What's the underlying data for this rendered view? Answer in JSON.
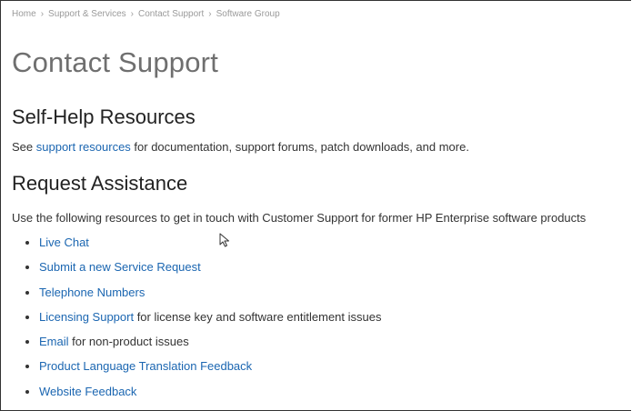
{
  "breadcrumb": [
    "Home",
    "Support & Services",
    "Contact Support",
    "Software Group"
  ],
  "breadcrumb_separator": "›",
  "page_title": "Contact Support",
  "self_help": {
    "heading": "Self-Help Resources",
    "text_before": "See ",
    "link": "support resources",
    "text_after": " for documentation, support forums, patch downloads, and more."
  },
  "request": {
    "heading": "Request Assistance",
    "intro": "Use the following resources to get in touch with Customer Support for former HP Enterprise software products",
    "items": [
      {
        "link": "Live Chat",
        "suffix": ""
      },
      {
        "link": "Submit a new Service Request",
        "suffix": ""
      },
      {
        "link": "Telephone Numbers",
        "suffix": ""
      },
      {
        "link": "Licensing Support",
        "suffix": " for license key and software entitlement issues"
      },
      {
        "link": "Email",
        "suffix": " for non-product issues"
      },
      {
        "link": "Product Language Translation Feedback",
        "suffix": ""
      },
      {
        "link": "Website Feedback",
        "suffix": ""
      }
    ]
  },
  "colors": {
    "link": "#1b66b1",
    "title": "#6f6f6f",
    "breadcrumb": "#9a9a9a",
    "text": "#333333"
  },
  "icons": {
    "pointer": "mouse-pointer-icon"
  }
}
